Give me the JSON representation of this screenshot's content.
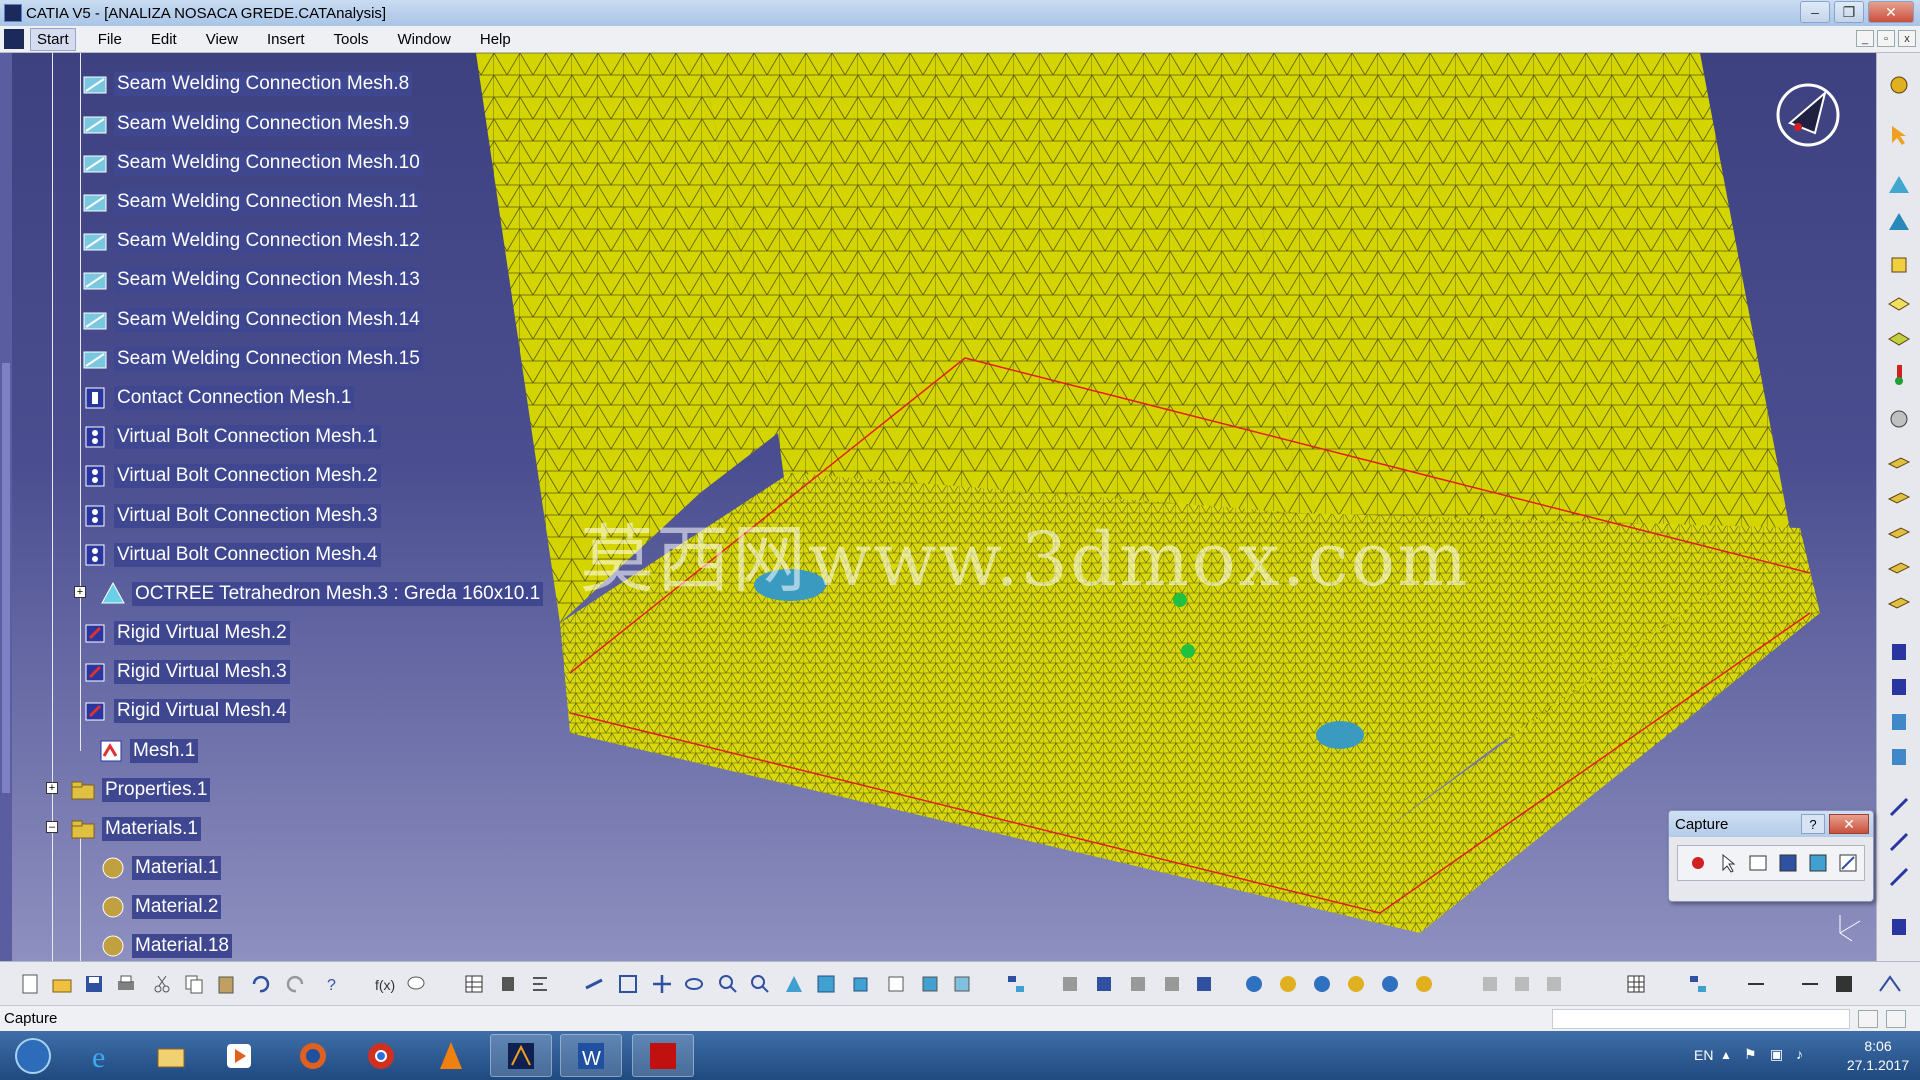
{
  "window": {
    "title": "CATIA V5 - [ANALIZA NOSACA GREDE.CATAnalysis]",
    "controls": [
      "–",
      "❐",
      "✕"
    ]
  },
  "menu": {
    "items": [
      "Start",
      "File",
      "Edit",
      "View",
      "Insert",
      "Tools",
      "Window",
      "Help"
    ]
  },
  "tree": {
    "nodes": [
      {
        "label": "Seam Welding Connection Mesh.8",
        "icon": "seam-weld-icon"
      },
      {
        "label": "Seam Welding Connection Mesh.9",
        "icon": "seam-weld-icon"
      },
      {
        "label": "Seam Welding Connection Mesh.10",
        "icon": "seam-weld-icon"
      },
      {
        "label": "Seam Welding Connection Mesh.11",
        "icon": "seam-weld-icon"
      },
      {
        "label": "Seam Welding Connection Mesh.12",
        "icon": "seam-weld-icon"
      },
      {
        "label": "Seam Welding Connection Mesh.13",
        "icon": "seam-weld-icon"
      },
      {
        "label": "Seam Welding Connection Mesh.14",
        "icon": "seam-weld-icon"
      },
      {
        "label": "Seam Welding Connection Mesh.15",
        "icon": "seam-weld-icon"
      },
      {
        "label": "Contact Connection Mesh.1",
        "icon": "contact-connection-icon"
      },
      {
        "label": "Virtual Bolt Connection Mesh.1",
        "icon": "virtual-bolt-icon"
      },
      {
        "label": "Virtual Bolt Connection Mesh.2",
        "icon": "virtual-bolt-icon"
      },
      {
        "label": "Virtual Bolt Connection Mesh.3",
        "icon": "virtual-bolt-icon"
      },
      {
        "label": "Virtual Bolt Connection Mesh.4",
        "icon": "virtual-bolt-icon"
      },
      {
        "label": "OCTREE Tetrahedron Mesh.3 : Greda 160x10.1",
        "icon": "octree-mesh-icon"
      },
      {
        "label": "Rigid Virtual Mesh.2",
        "icon": "rigid-virtual-icon"
      },
      {
        "label": "Rigid Virtual Mesh.3",
        "icon": "rigid-virtual-icon"
      },
      {
        "label": "Rigid Virtual Mesh.4",
        "icon": "rigid-virtual-icon"
      },
      {
        "label": "Mesh.1",
        "icon": "mesh-icon"
      },
      {
        "label": "Properties.1",
        "icon": "properties-folder-icon"
      },
      {
        "label": "Materials.1",
        "icon": "materials-folder-icon"
      },
      {
        "label": "Material.1",
        "icon": "material-sphere-icon"
      },
      {
        "label": "Material.2",
        "icon": "material-sphere-icon"
      },
      {
        "label": "Material.18",
        "icon": "material-sphere-icon"
      }
    ],
    "expanders": {
      "octree": "+",
      "properties": "+",
      "materials": "–"
    }
  },
  "viewport": {
    "watermark": "莫西网www.3dmox.com",
    "mesh_color": "#d8d800",
    "accent_red": "#e02020"
  },
  "capture": {
    "title": "Capture",
    "help": "?",
    "close": "✕"
  },
  "status": {
    "text": "Capture"
  },
  "taskbar": {
    "lang": "EN",
    "time": "8:06",
    "date": "27.1.2017"
  }
}
